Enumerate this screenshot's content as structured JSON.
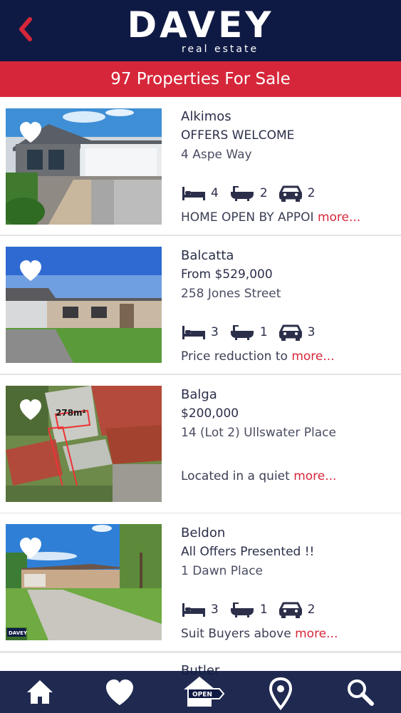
{
  "header": {
    "brand_name": "DAVEY",
    "brand_sub": "real estate",
    "back_icon": "chevron-left-icon",
    "colors": {
      "navy": "#0f1a44",
      "red": "#d6273a"
    }
  },
  "count_banner": "97 Properties For Sale",
  "listings": [
    {
      "suburb": "Alkimos",
      "headline": "OFFERS WELCOME",
      "address": "4 Aspe Way",
      "bedrooms": "4",
      "bathrooms": "2",
      "garages": "2",
      "snippet": "HOME OPEN BY APPOI",
      "more_label": "more..."
    },
    {
      "suburb": "Balcatta",
      "headline": "From $529,000",
      "address": "258 Jones Street",
      "bedrooms": "3",
      "bathrooms": "1",
      "garages": "3",
      "snippet": "Price reduction to",
      "more_label": "more..."
    },
    {
      "suburb": "Balga",
      "headline": "$200,000",
      "address": "14 (Lot 2) Ullswater Place",
      "area_label": "278m²",
      "snippet": "Located in a quiet",
      "more_label": "more..."
    },
    {
      "suburb": "Beldon",
      "headline": "All Offers Presented !!",
      "address": "1 Dawn Place",
      "bedrooms": "3",
      "bathrooms": "1",
      "garages": "2",
      "watermark": "DAVEY",
      "snippet": "Suit Buyers above",
      "more_label": "more..."
    },
    {
      "suburb": "Butler"
    }
  ],
  "tabs": [
    {
      "name": "home",
      "icon": "home-icon"
    },
    {
      "name": "favourites",
      "icon": "heart-icon"
    },
    {
      "name": "open-homes",
      "icon": "open-house-icon",
      "label": "OPEN"
    },
    {
      "name": "map",
      "icon": "map-pin-icon"
    },
    {
      "name": "search",
      "icon": "search-icon"
    }
  ]
}
